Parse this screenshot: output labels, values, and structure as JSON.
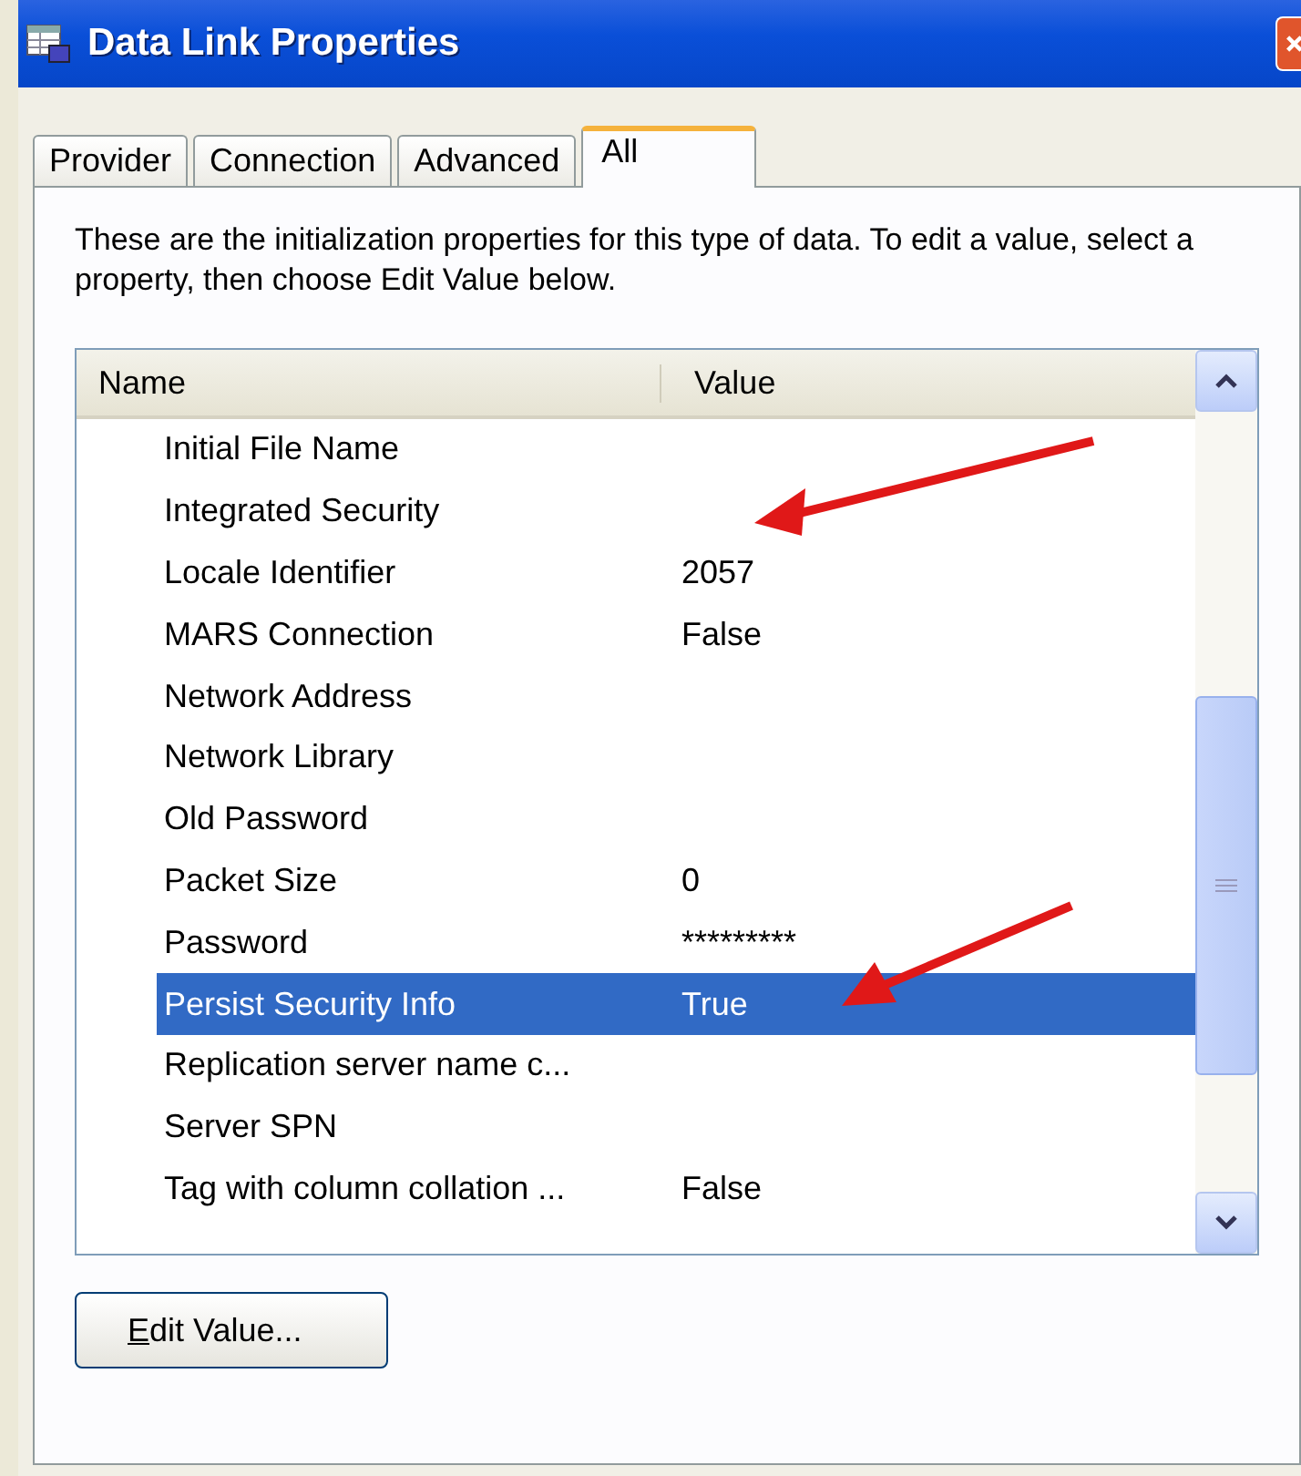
{
  "window": {
    "title": "Data Link Properties"
  },
  "tabs": [
    {
      "label": "Provider",
      "selected": false
    },
    {
      "label": "Connection",
      "selected": false
    },
    {
      "label": "Advanced",
      "selected": false
    },
    {
      "label": "All",
      "selected": true
    }
  ],
  "description": "These are the initialization properties for this type of data. To edit a value, select a property, then choose Edit Value below.",
  "table": {
    "columns": [
      "Name",
      "Value"
    ],
    "rows": [
      {
        "name": "Initial File Name",
        "selected": false
      },
      {
        "name": "Integrated Security",
        "selected": false
      },
      {
        "name": "Locale Identifier",
        "value": "2057",
        "selected": false
      },
      {
        "name": "MARS Connection",
        "value": "False",
        "selected": false
      },
      {
        "name": "Network Address",
        "selected": false
      },
      {
        "name": "Network Library",
        "selected": false
      },
      {
        "name": "Old Password",
        "selected": false
      },
      {
        "name": "Packet Size",
        "value": "0",
        "selected": false
      },
      {
        "name": "Password",
        "value": "*********",
        "selected": false
      },
      {
        "name": "Persist Security Info",
        "value": "True",
        "selected": true
      },
      {
        "name": "Replication server name c...",
        "selected": false
      },
      {
        "name": "Server SPN",
        "selected": false
      },
      {
        "name": "Tag with column collation ...",
        "value": "False",
        "selected": false
      }
    ]
  },
  "buttons": [
    "Edit Value..."
  ]
}
